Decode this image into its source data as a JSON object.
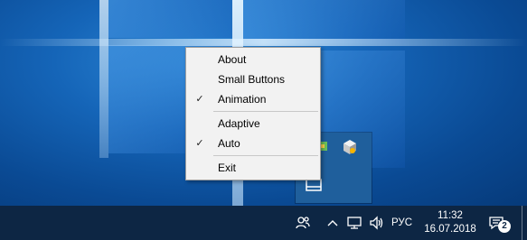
{
  "colors": {
    "desktop_bg": "#1565b8",
    "taskbar_bg": "#0d2644",
    "menu_bg": "#f2f2f2",
    "tray_flyout_bg": "#1f5f9c"
  },
  "context_menu": {
    "items": [
      {
        "label": "About",
        "checked": false
      },
      {
        "label": "Small Buttons",
        "checked": false
      },
      {
        "label": "Animation",
        "checked": true
      },
      {
        "label": "Adaptive",
        "checked": false
      },
      {
        "label": "Auto",
        "checked": true
      },
      {
        "label": "Exit",
        "checked": false
      }
    ],
    "check_glyph": "✓"
  },
  "tray_flyout": {
    "icons": [
      "app-tray-icon",
      "cube-app-icon",
      "window-app-icon"
    ]
  },
  "taskbar": {
    "icons": [
      "people-icon",
      "chevron-up-icon",
      "network-icon",
      "volume-icon",
      "action-center-icon"
    ],
    "language": "РУС",
    "time": "11:32",
    "date": "16.07.2018",
    "notification_count": "2"
  }
}
